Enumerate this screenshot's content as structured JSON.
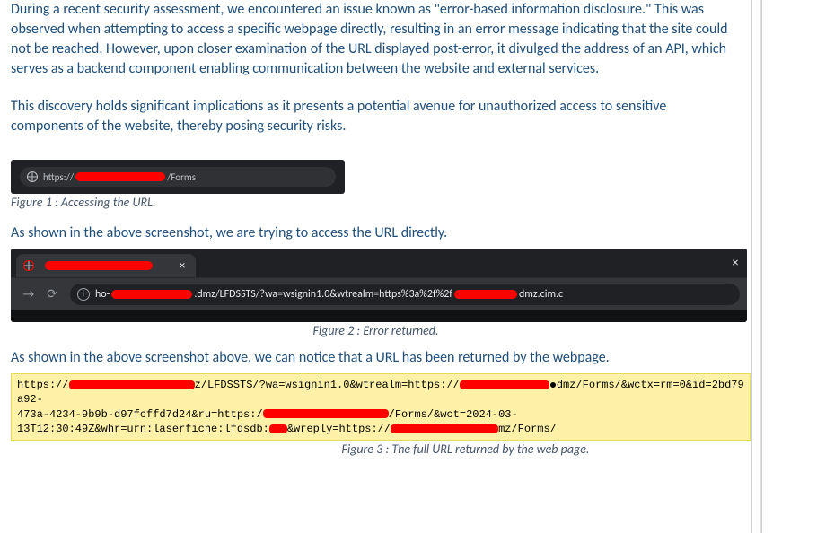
{
  "paragraphs": {
    "p1": "During a recent security assessment, we encountered an issue known as \"error-based information disclosure.\" This was observed when attempting to access a specific webpage directly, resulting in an error message indicating that the site could not be reached. However, upon closer examination of the URL displayed post-error, it divulged the address of an API, which serves as a backend component enabling communication between the website and external services.",
    "p2": "This discovery holds significant implications as it presents a potential avenue for unauthorized access to sensitive components of the website, thereby posing security risks.",
    "p3": "As shown in the above screenshot, we are trying to access the URL directly.",
    "p4": "As shown in the above screenshot above, we can notice that a URL has been returned by the webpage."
  },
  "captions": {
    "fig1": "Figure 1 : Accessing the URL.",
    "fig2": "Figure 2 : Error returned.",
    "fig3": "Figure 3 : The full URL returned by the web page."
  },
  "fig1": {
    "scheme": "https://",
    "suffix": "/Forms"
  },
  "fig2": {
    "addr_prefix": "ho-",
    "addr_mid": ".dmz/LFDSSTS/?wa=wsignin1.0&wtrealm=https%3a%2f%2f",
    "addr_suffix": "dmz.cim.c"
  },
  "fig3": {
    "l1a": "https://",
    "l1b": "z/LFDSSTS/?wa=wsignin1.0&wtrealm=https://",
    "l1c": "dmz/Forms/&wctx=rm=0&id=2bd79a92-",
    "l2a": "473a-4234-9b9b-d97fcffd7d24&ru=https:/",
    "l2b": "/Forms/&wct=2024-03-",
    "l3a": "13T12:30:49Z&whr=urn:laserfiche:lfdsdb:",
    "l3b": "&wreply=https://",
    "l3c": "mz/Forms/"
  },
  "icons": {
    "close": "×",
    "arrow": "→",
    "reload": "⟳",
    "info": "i"
  }
}
